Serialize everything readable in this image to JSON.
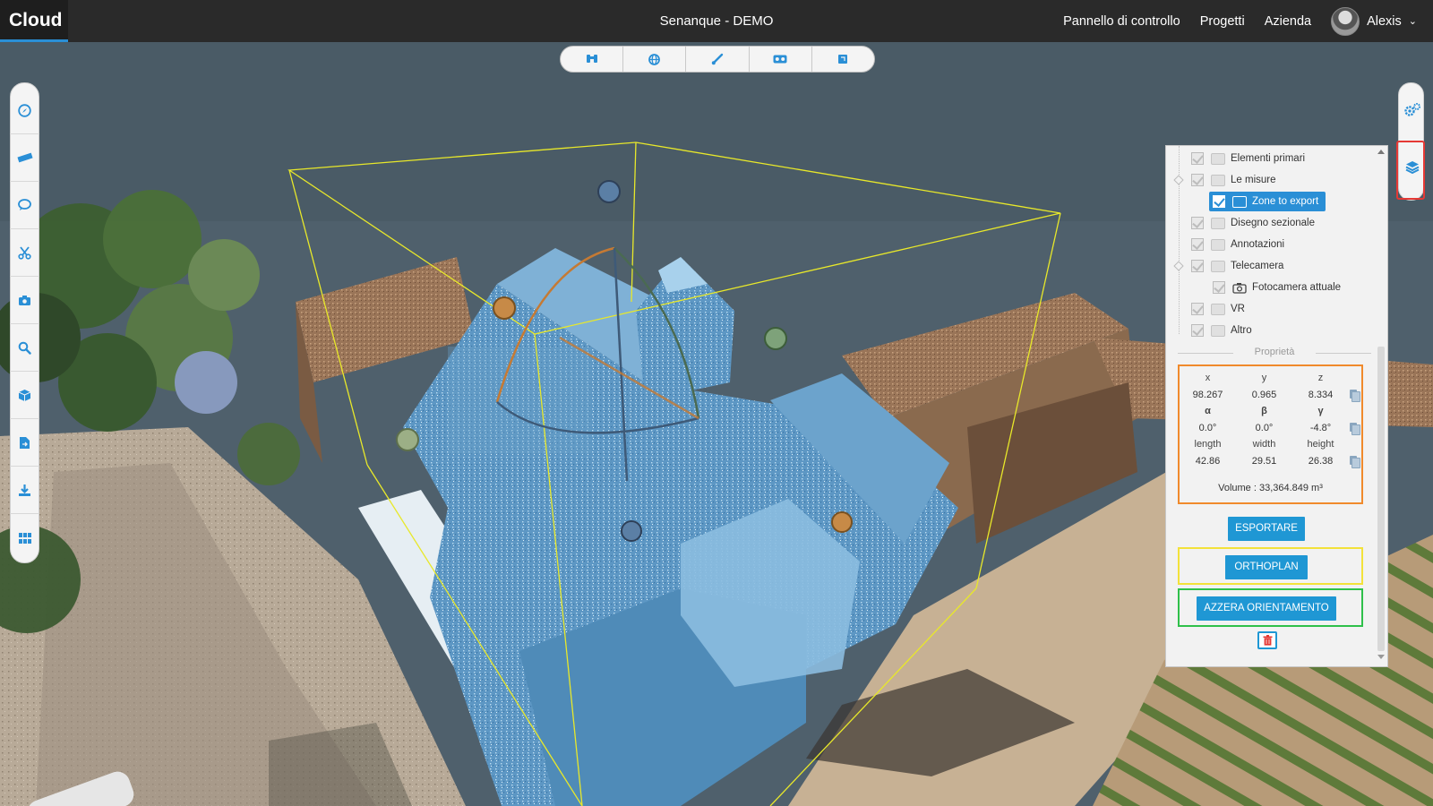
{
  "app": {
    "brand": "Cloud",
    "project_title": "Senanque - DEMO"
  },
  "nav": {
    "items": [
      "Pannello di controllo",
      "Progetti",
      "Azienda"
    ],
    "user_name": "Alexis"
  },
  "top_tools": [
    {
      "icon": "binoculars-icon"
    },
    {
      "icon": "globe-icon"
    },
    {
      "icon": "brush-icon"
    },
    {
      "icon": "vr-glasses-icon"
    },
    {
      "icon": "cube-icon"
    }
  ],
  "left_tools": [
    {
      "icon": "compass-icon"
    },
    {
      "icon": "ruler-icon"
    },
    {
      "icon": "comment-icon"
    },
    {
      "icon": "scissors-icon"
    },
    {
      "icon": "camera-icon"
    },
    {
      "icon": "search-icon"
    },
    {
      "icon": "cube-icon"
    },
    {
      "icon": "file-export-icon"
    },
    {
      "icon": "download-icon"
    },
    {
      "icon": "grid-icon"
    }
  ],
  "right_tools": [
    {
      "icon": "cogs-icon"
    },
    {
      "icon": "layers-icon"
    }
  ],
  "tree": [
    {
      "label": "Elementi primari",
      "level": 0
    },
    {
      "label": "Le misure",
      "level": 0
    },
    {
      "label": "Zone to export",
      "level": 1,
      "selected": true
    },
    {
      "label": "Disegno sezionale",
      "level": 0
    },
    {
      "label": "Annotazioni",
      "level": 0
    },
    {
      "label": "Telecamera",
      "level": 0
    },
    {
      "label": "Fotocamera attuale",
      "level": 1
    },
    {
      "label": "VR",
      "level": 0
    },
    {
      "label": "Altro",
      "level": 0
    }
  ],
  "properties": {
    "title": "Proprietà",
    "position": {
      "labels": [
        "x",
        "y",
        "z"
      ],
      "values": [
        "98.267",
        "0.965",
        "8.334"
      ]
    },
    "rotation": {
      "labels": [
        "α",
        "β",
        "γ"
      ],
      "values": [
        "0.0°",
        "0.0°",
        "-4.8°"
      ]
    },
    "size": {
      "labels": [
        "length",
        "width",
        "height"
      ],
      "values": [
        "42.86",
        "29.51",
        "26.38"
      ]
    },
    "volume": "Volume : 33,364.849 m³"
  },
  "buttons": {
    "export": "ESPORTARE",
    "orthoplan": "ORTHOPLAN",
    "reset_orientation": "AZZERA ORIENTAMENTO"
  },
  "colors": {
    "accent": "#2a8fd6",
    "button": "#1f97d4",
    "box_orange": "#f08a2c",
    "box_yellow": "#f3e23a",
    "box_green": "#2fc04a",
    "highlight_red": "#e53935"
  }
}
